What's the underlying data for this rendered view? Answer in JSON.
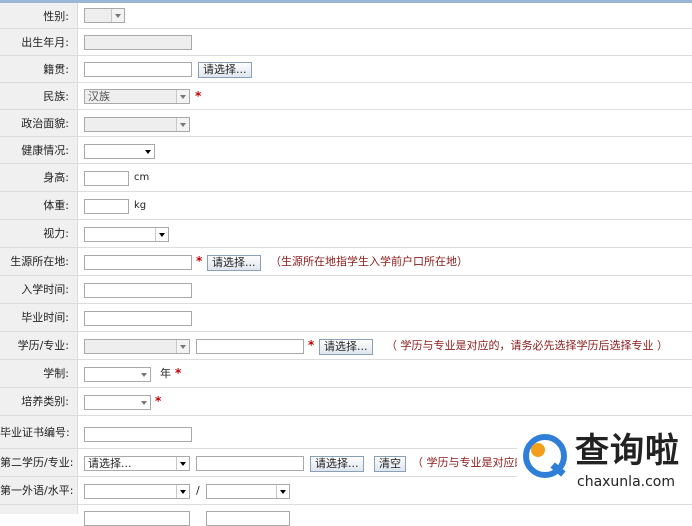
{
  "fields": {
    "gender": {
      "label": "性别:"
    },
    "birth": {
      "label": "出生年月:"
    },
    "native": {
      "label": "籍贯:",
      "choose": "请选择..."
    },
    "ethnic": {
      "label": "民族:",
      "value": "汉族"
    },
    "political": {
      "label": "政治面貌:"
    },
    "health": {
      "label": "健康情况:"
    },
    "height": {
      "label": "身高:",
      "unit": "cm"
    },
    "weight": {
      "label": "体重:",
      "unit": "kg"
    },
    "vision": {
      "label": "视力:"
    },
    "origin": {
      "label": "生源所在地:",
      "choose": "请选择...",
      "note": "（生源所在地指学生入学前户口所在地）"
    },
    "enroll": {
      "label": "入学时间:"
    },
    "graduate": {
      "label": "毕业时间:"
    },
    "degree_major": {
      "label": "学历/专业:",
      "choose": "请选择...",
      "note": "（ 学历与专业是对应的，请务必先选择学历后选择专业 ）"
    },
    "years": {
      "label": "学制:",
      "unit": "年"
    },
    "training": {
      "label": "培养类别:"
    },
    "certificate": {
      "label": "毕业证书编号:"
    },
    "second_degree": {
      "label": "第二学历/专业:",
      "select_value": "请选择...",
      "choose": "请选择...",
      "clear": "清空",
      "note": "（ 学历与专业是对应的"
    },
    "language": {
      "label": "第一外语/水平:",
      "separator": "/"
    }
  },
  "required_mark": "*",
  "watermark": {
    "title": "查询啦",
    "url": "chaxunla.com"
  }
}
